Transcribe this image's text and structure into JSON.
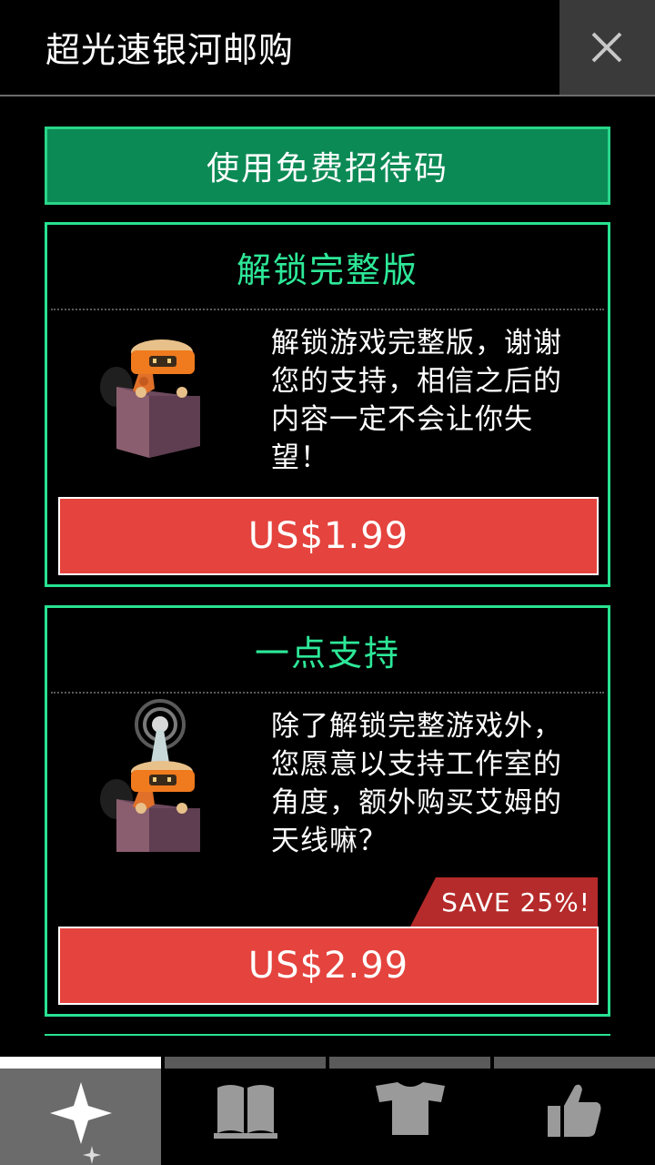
{
  "header": {
    "title": "超光速银河邮购",
    "close_icon": "close-icon"
  },
  "promo": {
    "label": "使用免费招待码"
  },
  "offers": [
    {
      "title": "解锁完整版",
      "description": "解锁游戏完整版，谢谢您的支持，相信之后的内容一定不会让你失望！",
      "price": "US$1.99",
      "icon": "robot-in-box-icon"
    },
    {
      "title": "一点支持",
      "description": "除了解锁完整游戏外，您愿意以支持工作室的角度，额外购买艾姆的天线嘛？",
      "price": "US$2.99",
      "badge": "SAVE 25%!",
      "icon": "robot-antenna-icon"
    }
  ],
  "tabs": [
    {
      "icon": "sparkle-icon",
      "active": true
    },
    {
      "icon": "book-icon",
      "active": false
    },
    {
      "icon": "shirt-icon",
      "active": false
    },
    {
      "icon": "thumbs-up-icon",
      "active": false
    }
  ],
  "colors": {
    "accent_green": "#27e290",
    "promo_green": "#0b8a55",
    "price_red": "#e5433e",
    "badge_red": "#b52a2a"
  }
}
